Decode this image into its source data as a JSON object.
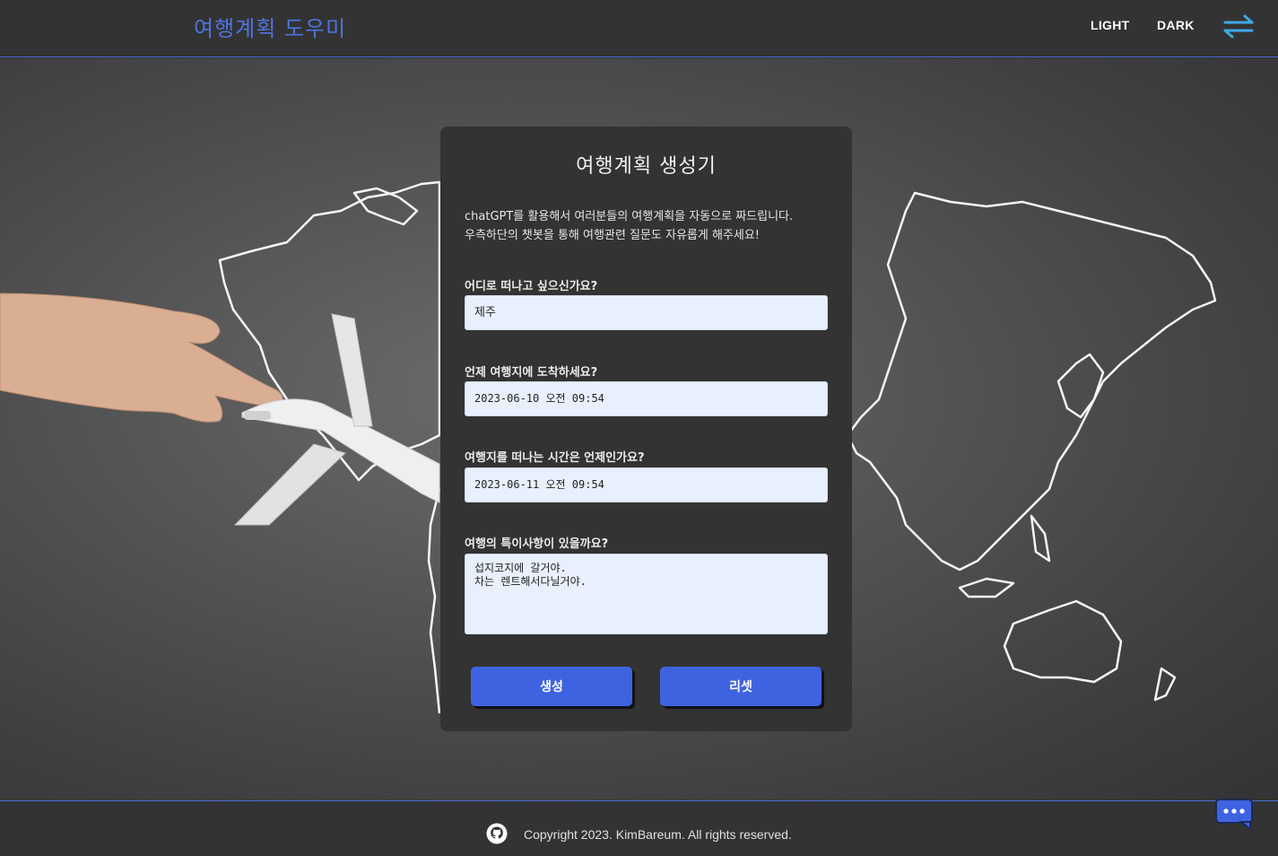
{
  "header": {
    "logo": "여행계획 도우미",
    "nav": {
      "light": "LIGHT",
      "dark": "DARK"
    },
    "toggle_icon": "swap-arrows-icon"
  },
  "form": {
    "title": "여행계획 생성기",
    "description_line1": "chatGPT를 활용해서 여러분들의 여행계획을 자동으로 짜드립니다.",
    "description_line2": "우측하단의 챗봇을 통해 여행관련 질문도 자유롭게 해주세요!",
    "destination": {
      "label": "어디로 떠나고 싶으신가요?",
      "value": "제주"
    },
    "arrival": {
      "label": "언제 여행지에 도착하세요?",
      "value": "2023-06-10 오전 09:54"
    },
    "departure": {
      "label": "여행지를 떠나는 시간은 언제인가요?",
      "value": "2023-06-11 오전 09:54"
    },
    "notes": {
      "label": "여행의 특이사항이 있을까요?",
      "value": "섭지코지에 갈거야.\n차는 렌트해서다닐거야."
    },
    "generate_label": "생성",
    "reset_label": "리셋"
  },
  "footer": {
    "copyright": "Copyright 2023. KimBareum. All rights reserved.",
    "github_icon": "github-icon"
  },
  "chatbot_icon": "chat-bubble-icon",
  "colors": {
    "accent": "#3f63e0",
    "logo": "#4d74e0",
    "panel": "#333333",
    "input_bg": "#e8f0fe"
  }
}
